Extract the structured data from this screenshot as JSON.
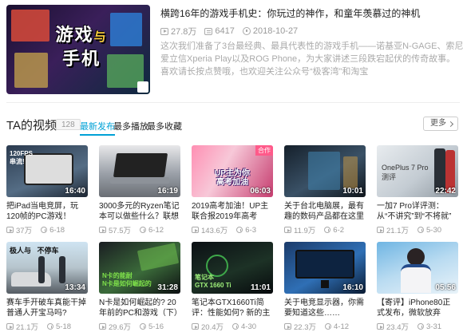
{
  "featured": {
    "thumb_title_line1": "游戏",
    "thumb_title_mid": "与",
    "thumb_title_line2": "手机",
    "title": "横跨16年的游戏手机史：你玩过的神作，和童年羡慕过的神机",
    "views": "27.8万",
    "danmaku": "6417",
    "date": "2018-10-27",
    "description": "这次我们准备了3台最经典、最具代表性的游戏手机——诺基亚N-GAGE、索尼爱立信Xperia Play以及ROG Phone，为大家讲述三段跌宕起伏的传奇故事。喜欢请长按点赞哦，也欢迎关注公众号“极客湾”和淘宝"
  },
  "section": {
    "title": "TA的视频",
    "count": "128",
    "tabs": [
      "最新发布",
      "最多播放",
      "最多收藏"
    ],
    "more_label": "更多"
  },
  "videos": [
    {
      "thumb_text": "120FPS\n串流!",
      "duration": "16:40",
      "title": "把iPad当电竞屏，玩120帧的PC游戏！",
      "views": "37万",
      "date": "6-18"
    },
    {
      "thumb_text": "",
      "duration": "16:19",
      "title": "3000多元的Ryzen笔记本可以做些什么？联想小新14 锐",
      "views": "57.5万",
      "date": "6-12"
    },
    {
      "thumb_text": "UP主为你\n高考加油",
      "duration": "06:03",
      "badge": "合作",
      "title": "2019高考加油！UP主联合报2019年高考",
      "views": "143.6万",
      "date": "6-3"
    },
    {
      "thumb_text": "",
      "duration": "10:01",
      "title": "关于台北电脑展，最有趣的数码产品都在这里了……",
      "views": "11.9万",
      "date": "6-2"
    },
    {
      "thumb_text": "OnePlus 7 Pro\n测评",
      "duration": "22:42",
      "title": "一加7 Pro详评测：从“不讲究”到“不将就”",
      "views": "21.1万",
      "date": "5-30"
    },
    {
      "thumb_text": "极人与   不停车",
      "duration": "13:34",
      "title": "赛车手开破车真能干掉普通人开宝马吗?",
      "views": "21.1万",
      "date": "5-18"
    },
    {
      "thumb_text": "N卡的能耐\nN卡是如何崛起的",
      "duration": "31:28",
      "title": "N卡是如何崛起的? 20年前的PC和游戏（下）",
      "views": "29.6万",
      "date": "5-16"
    },
    {
      "thumb_text": "笔记本\nGTX 1660 Ti",
      "duration": "11:01",
      "title": "笔记本GTX1660Ti简评：性能如何? 新的主流游戏本诞生",
      "views": "20.4万",
      "date": "4-30"
    },
    {
      "thumb_text": "",
      "duration": "16:10",
      "title": "关于电竞显示器，你需要知道这些……",
      "views": "22.3万",
      "date": "4-12"
    },
    {
      "thumb_text": "",
      "duration": "05:56",
      "title": "【寄评】iPhone80正式发布，微软放弃WIN10系统",
      "views": "23.4万",
      "date": "3-31"
    }
  ],
  "colors": {
    "accent": "#00a1d6",
    "meta": "#999999",
    "title": "#222222"
  }
}
